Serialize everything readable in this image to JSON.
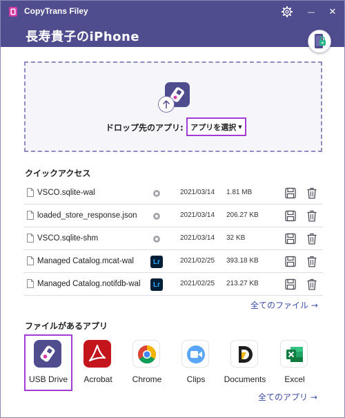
{
  "window": {
    "app_title": "CopyTrans Filey",
    "settings_icon": "gear-icon",
    "minimize_icon": "minimize-icon",
    "close_icon": "close-icon",
    "close_glyph": "✕",
    "minimize_glyph": "—"
  },
  "header": {
    "device_name": "長寿貴子のiPhone",
    "device_badge_icon": "iphone-lock-icon"
  },
  "dropzone": {
    "icon": "usb-drive-upload-icon",
    "label": "ドロップ先のアプリ:",
    "select_value": "アプリを選択",
    "select_caret": "▼"
  },
  "quick_access": {
    "title": "クイックアクセス",
    "files": [
      {
        "name": "VSCO.sqlite-wal",
        "source": "circle",
        "date": "2021/03/14",
        "size": "1.81 MB"
      },
      {
        "name": "loaded_store_response.json",
        "source": "circle",
        "date": "2021/03/14",
        "size": "206.27 KB"
      },
      {
        "name": "VSCO.sqlite-shm",
        "source": "circle",
        "date": "2021/03/14",
        "size": "32 KB"
      },
      {
        "name": "Managed Catalog.mcat-wal",
        "source": "Lr",
        "date": "2021/02/25",
        "size": "393.18 KB"
      },
      {
        "name": "Managed Catalog.notifdb-wal",
        "source": "Lr",
        "date": "2021/02/25",
        "size": "213.27 KB"
      }
    ],
    "all_files_link": "全てのファイル →"
  },
  "apps": {
    "title": "ファイルがあるアプリ",
    "items": [
      {
        "label": "USB Drive",
        "icon": "usb-drive-icon",
        "selected": true
      },
      {
        "label": "Acrobat",
        "icon": "acrobat-icon"
      },
      {
        "label": "Chrome",
        "icon": "chrome-icon"
      },
      {
        "label": "Clips",
        "icon": "clips-icon"
      },
      {
        "label": "Documents",
        "icon": "documents-icon"
      },
      {
        "label": "Excel",
        "icon": "excel-icon"
      }
    ],
    "all_apps_link": "全てのアプリ →"
  },
  "colors": {
    "brand": "#4f4d8e",
    "highlight": "#a13bd6",
    "link": "#3b4aa8"
  }
}
